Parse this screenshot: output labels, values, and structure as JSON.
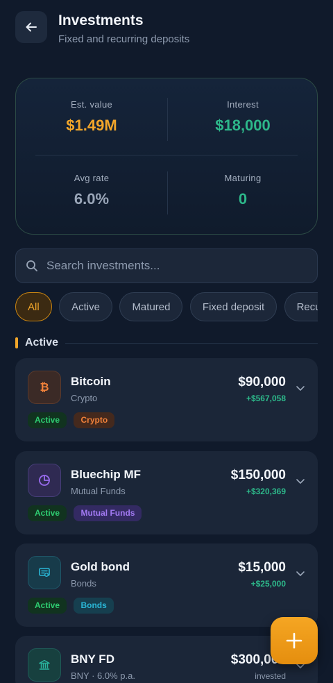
{
  "header": {
    "title": "Investments",
    "subtitle": "Fixed and recurring deposits"
  },
  "stats": {
    "est_value": {
      "label": "Est. value",
      "value": "$1.49M",
      "color": "#f2a62a"
    },
    "interest": {
      "label": "Interest",
      "value": "$18,000",
      "color": "#2db88a"
    },
    "avg_rate": {
      "label": "Avg rate",
      "value": "6.0%",
      "color": "#9aa6b8"
    },
    "maturing": {
      "label": "Maturing",
      "value": "0",
      "color": "#2db88a"
    }
  },
  "search": {
    "placeholder": "Search investments...",
    "value": ""
  },
  "filters": [
    "All",
    "Active",
    "Matured",
    "Fixed deposit",
    "Recurring"
  ],
  "active_filter": "All",
  "section": {
    "title": "Active"
  },
  "investments": [
    {
      "name": "Bitcoin",
      "subtitle": "Crypto",
      "amount": "$90,000",
      "gain": "+$567,058",
      "status": "Active",
      "category": "Crypto",
      "icon": "bitcoin-icon",
      "accent": "#f0813a"
    },
    {
      "name": "Bluechip MF",
      "subtitle": "Mutual Funds",
      "amount": "$150,000",
      "gain": "+$320,369",
      "status": "Active",
      "category": "Mutual Funds",
      "icon": "pie-chart-icon",
      "accent": "#9a6cf0"
    },
    {
      "name": "Gold bond",
      "subtitle": "Bonds",
      "amount": "$15,000",
      "gain": "+$25,000",
      "status": "Active",
      "category": "Bonds",
      "icon": "certificate-icon",
      "accent": "#2ab6d6"
    },
    {
      "name": "BNY FD",
      "subtitle": "BNY · 6.0% p.a.",
      "amount": "$300,000",
      "gain": "invested",
      "status": "",
      "category": "",
      "icon": "bank-icon",
      "accent": "#2ab6a0"
    }
  ]
}
